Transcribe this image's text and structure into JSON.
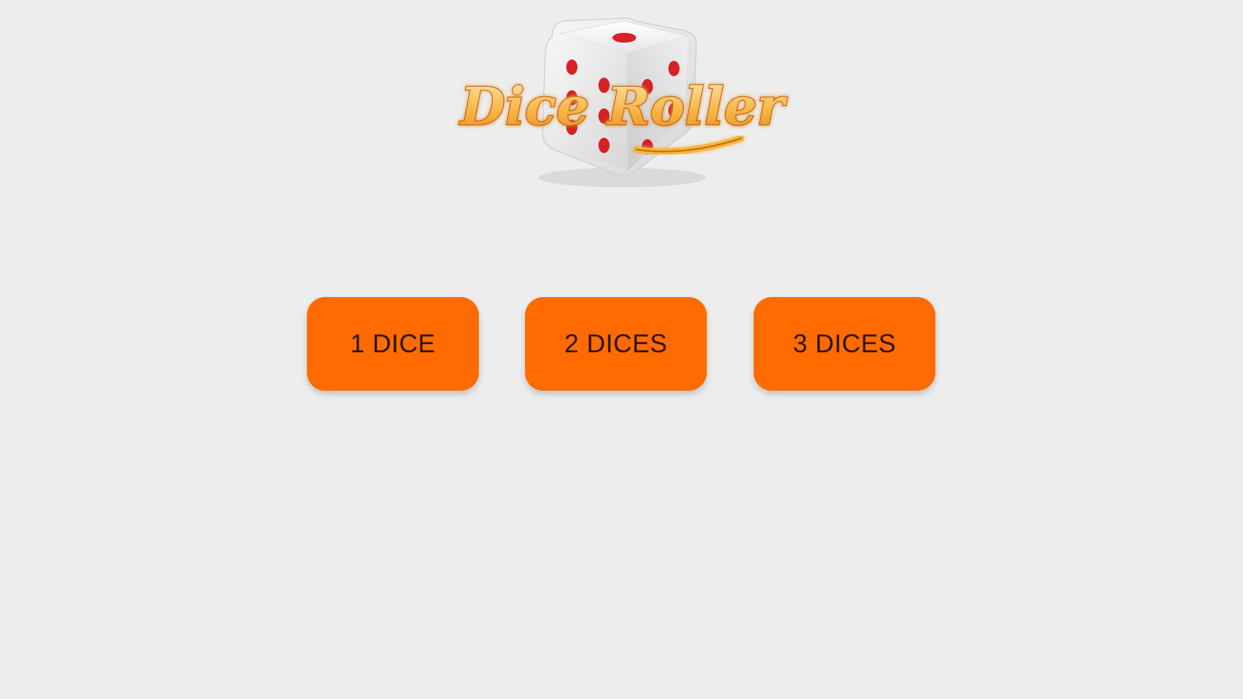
{
  "app": {
    "logo_text": "Dice Roller",
    "logo_icon": "die-icon"
  },
  "buttons": [
    {
      "label": "1 DICE"
    },
    {
      "label": "2 DICES"
    },
    {
      "label": "3 DICES"
    }
  ],
  "colors": {
    "background": "#ededed",
    "button": "#ff6b00",
    "button_text": "#2b1409",
    "logo_text_fill": "#f6b73c",
    "logo_text_outline": "#c7650f",
    "die_pip": "#d72127"
  }
}
